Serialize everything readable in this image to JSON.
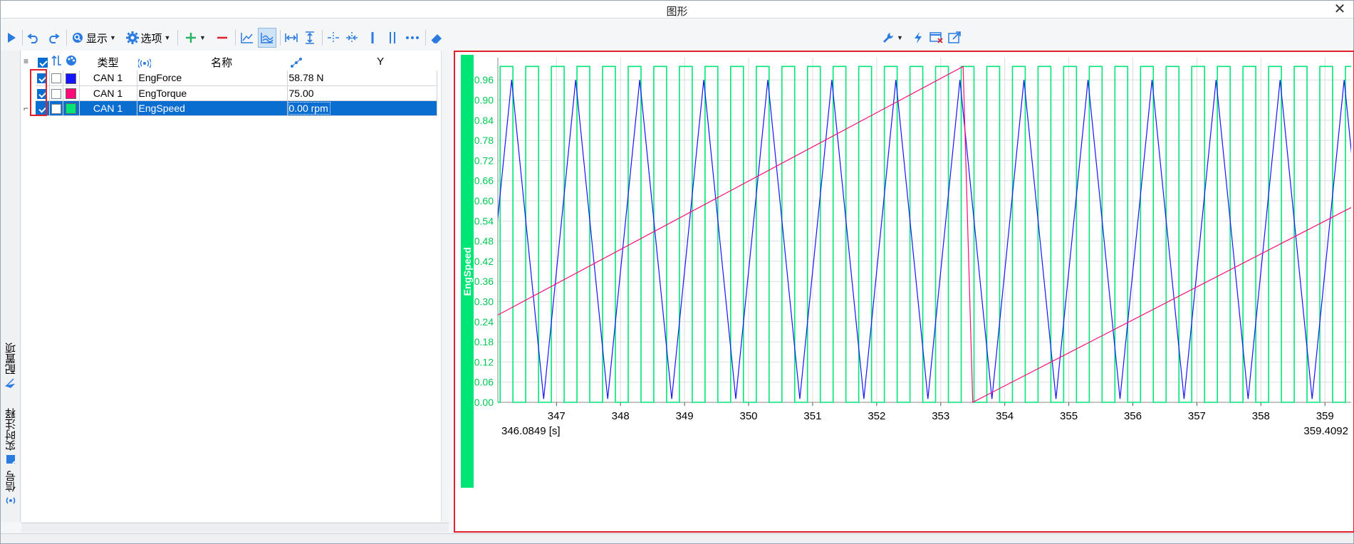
{
  "window": {
    "title": "图形",
    "close_glyph": "✕"
  },
  "toolbar": {
    "display_label": "显示",
    "options_label": "选项",
    "icons": [
      "play-icon",
      "undo-icon",
      "redo-icon",
      "display-icon",
      "gear-icon",
      "add-icon",
      "remove-icon",
      "line-chart-icon",
      "multi-line-chart-icon",
      "fit-horizontal-icon",
      "fit-vertical-icon",
      "cursor-horizontal-icon",
      "cursor-split-icon",
      "single-cursor-icon",
      "double-cursor-icon",
      "more-icon",
      "eraser-icon",
      "wrench-icon",
      "flash-icon",
      "window-close-icon",
      "export-icon"
    ]
  },
  "side_tabs": [
    {
      "label": "配置项",
      "icon": "config-icon"
    },
    {
      "label": "实时注释",
      "icon": "annotation-icon"
    },
    {
      "label": "信号",
      "icon": "signal-icon"
    }
  ],
  "signal_table": {
    "headers": {
      "type": "类型",
      "name": "名称",
      "value": "Y"
    },
    "rows": [
      {
        "enabled": true,
        "axis": false,
        "color": "#1414ff",
        "type": "CAN 1",
        "name": "EngForce",
        "value": "58.78 N",
        "selected": false
      },
      {
        "enabled": true,
        "axis": false,
        "color": "#ff0a78",
        "type": "CAN 1",
        "name": "EngTorque",
        "value": "75.00",
        "selected": false
      },
      {
        "enabled": true,
        "axis": false,
        "color": "#00e676",
        "type": "CAN 1",
        "name": "EngSpeed",
        "value": "0.00 rpm",
        "selected": true
      }
    ]
  },
  "chart_data": {
    "type": "line",
    "ylabel": "EngSpeed",
    "ylim": [
      0.0,
      1.0
    ],
    "y_ticks": [
      "0.00",
      "0.06",
      "0.12",
      "0.18",
      "0.24",
      "0.30",
      "0.36",
      "0.42",
      "0.48",
      "0.54",
      "0.60",
      "0.66",
      "0.72",
      "0.78",
      "0.84",
      "0.90",
      "0.96"
    ],
    "xlim": [
      346.0849,
      359.4092
    ],
    "x_ticks": [
      "347",
      "348",
      "349",
      "350",
      "351",
      "352",
      "353",
      "354",
      "355",
      "356",
      "357",
      "358",
      "359"
    ],
    "x_start_label": "346.0849 [s]",
    "x_end_label": "359.4092",
    "grid": true,
    "series": [
      {
        "name": "EngSpeed",
        "color": "#00e676",
        "kind": "square",
        "period": 0.4,
        "high": 1.0,
        "low": 0.0,
        "first_rise": 346.12
      },
      {
        "name": "EngForce",
        "color": "#1414ff",
        "kind": "triangle",
        "period": 1.0,
        "peak": 0.96,
        "trough": 0.01,
        "first_peak": 346.3
      },
      {
        "name": "EngTorque",
        "color": "#ff0a78",
        "kind": "sawtooth",
        "points": [
          [
            346.0849,
            0.26
          ],
          [
            353.35,
            1.0
          ],
          [
            353.5,
            0.0
          ],
          [
            359.4092,
            0.58
          ]
        ]
      }
    ]
  }
}
